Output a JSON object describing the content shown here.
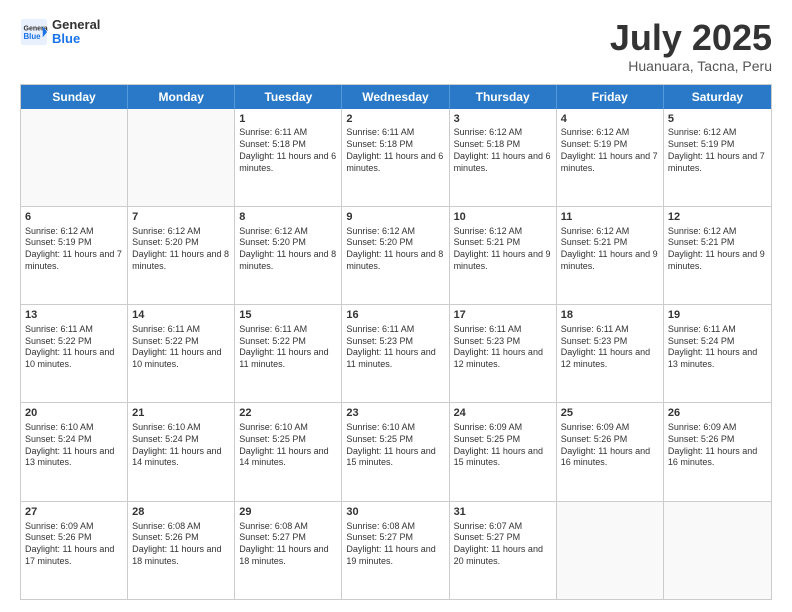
{
  "header": {
    "logo_line1": "General",
    "logo_line2": "Blue",
    "title": "July 2025",
    "subtitle": "Huanuara, Tacna, Peru"
  },
  "days_of_week": [
    "Sunday",
    "Monday",
    "Tuesday",
    "Wednesday",
    "Thursday",
    "Friday",
    "Saturday"
  ],
  "weeks": [
    [
      {
        "day": "",
        "info": ""
      },
      {
        "day": "",
        "info": ""
      },
      {
        "day": "1",
        "info": "Sunrise: 6:11 AM\nSunset: 5:18 PM\nDaylight: 11 hours and 6 minutes."
      },
      {
        "day": "2",
        "info": "Sunrise: 6:11 AM\nSunset: 5:18 PM\nDaylight: 11 hours and 6 minutes."
      },
      {
        "day": "3",
        "info": "Sunrise: 6:12 AM\nSunset: 5:18 PM\nDaylight: 11 hours and 6 minutes."
      },
      {
        "day": "4",
        "info": "Sunrise: 6:12 AM\nSunset: 5:19 PM\nDaylight: 11 hours and 7 minutes."
      },
      {
        "day": "5",
        "info": "Sunrise: 6:12 AM\nSunset: 5:19 PM\nDaylight: 11 hours and 7 minutes."
      }
    ],
    [
      {
        "day": "6",
        "info": "Sunrise: 6:12 AM\nSunset: 5:19 PM\nDaylight: 11 hours and 7 minutes."
      },
      {
        "day": "7",
        "info": "Sunrise: 6:12 AM\nSunset: 5:20 PM\nDaylight: 11 hours and 8 minutes."
      },
      {
        "day": "8",
        "info": "Sunrise: 6:12 AM\nSunset: 5:20 PM\nDaylight: 11 hours and 8 minutes."
      },
      {
        "day": "9",
        "info": "Sunrise: 6:12 AM\nSunset: 5:20 PM\nDaylight: 11 hours and 8 minutes."
      },
      {
        "day": "10",
        "info": "Sunrise: 6:12 AM\nSunset: 5:21 PM\nDaylight: 11 hours and 9 minutes."
      },
      {
        "day": "11",
        "info": "Sunrise: 6:12 AM\nSunset: 5:21 PM\nDaylight: 11 hours and 9 minutes."
      },
      {
        "day": "12",
        "info": "Sunrise: 6:12 AM\nSunset: 5:21 PM\nDaylight: 11 hours and 9 minutes."
      }
    ],
    [
      {
        "day": "13",
        "info": "Sunrise: 6:11 AM\nSunset: 5:22 PM\nDaylight: 11 hours and 10 minutes."
      },
      {
        "day": "14",
        "info": "Sunrise: 6:11 AM\nSunset: 5:22 PM\nDaylight: 11 hours and 10 minutes."
      },
      {
        "day": "15",
        "info": "Sunrise: 6:11 AM\nSunset: 5:22 PM\nDaylight: 11 hours and 11 minutes."
      },
      {
        "day": "16",
        "info": "Sunrise: 6:11 AM\nSunset: 5:23 PM\nDaylight: 11 hours and 11 minutes."
      },
      {
        "day": "17",
        "info": "Sunrise: 6:11 AM\nSunset: 5:23 PM\nDaylight: 11 hours and 12 minutes."
      },
      {
        "day": "18",
        "info": "Sunrise: 6:11 AM\nSunset: 5:23 PM\nDaylight: 11 hours and 12 minutes."
      },
      {
        "day": "19",
        "info": "Sunrise: 6:11 AM\nSunset: 5:24 PM\nDaylight: 11 hours and 13 minutes."
      }
    ],
    [
      {
        "day": "20",
        "info": "Sunrise: 6:10 AM\nSunset: 5:24 PM\nDaylight: 11 hours and 13 minutes."
      },
      {
        "day": "21",
        "info": "Sunrise: 6:10 AM\nSunset: 5:24 PM\nDaylight: 11 hours and 14 minutes."
      },
      {
        "day": "22",
        "info": "Sunrise: 6:10 AM\nSunset: 5:25 PM\nDaylight: 11 hours and 14 minutes."
      },
      {
        "day": "23",
        "info": "Sunrise: 6:10 AM\nSunset: 5:25 PM\nDaylight: 11 hours and 15 minutes."
      },
      {
        "day": "24",
        "info": "Sunrise: 6:09 AM\nSunset: 5:25 PM\nDaylight: 11 hours and 15 minutes."
      },
      {
        "day": "25",
        "info": "Sunrise: 6:09 AM\nSunset: 5:26 PM\nDaylight: 11 hours and 16 minutes."
      },
      {
        "day": "26",
        "info": "Sunrise: 6:09 AM\nSunset: 5:26 PM\nDaylight: 11 hours and 16 minutes."
      }
    ],
    [
      {
        "day": "27",
        "info": "Sunrise: 6:09 AM\nSunset: 5:26 PM\nDaylight: 11 hours and 17 minutes."
      },
      {
        "day": "28",
        "info": "Sunrise: 6:08 AM\nSunset: 5:26 PM\nDaylight: 11 hours and 18 minutes."
      },
      {
        "day": "29",
        "info": "Sunrise: 6:08 AM\nSunset: 5:27 PM\nDaylight: 11 hours and 18 minutes."
      },
      {
        "day": "30",
        "info": "Sunrise: 6:08 AM\nSunset: 5:27 PM\nDaylight: 11 hours and 19 minutes."
      },
      {
        "day": "31",
        "info": "Sunrise: 6:07 AM\nSunset: 5:27 PM\nDaylight: 11 hours and 20 minutes."
      },
      {
        "day": "",
        "info": ""
      },
      {
        "day": "",
        "info": ""
      }
    ]
  ]
}
